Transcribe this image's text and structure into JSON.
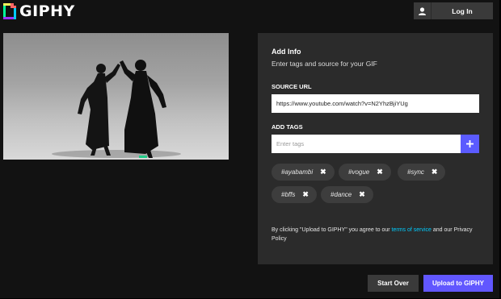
{
  "header": {
    "logo_text": "GIPHY",
    "login_label": "Log In"
  },
  "panel": {
    "title": "Add Info",
    "subtitle": "Enter tags and source for your GIF",
    "source_url_label": "SOURCE URL",
    "source_url_value": "https://www.youtube.com/watch?v=N2YhzBjiYUg",
    "add_tags_label": "ADD TAGS",
    "tags_placeholder": "Enter tags",
    "tags": [
      {
        "label": "#ayabambi"
      },
      {
        "label": "#vogue"
      },
      {
        "label": "#sync"
      },
      {
        "label": "#bffs"
      },
      {
        "label": "#dance"
      }
    ],
    "terms_prefix": "By clicking \"Upload to GIPHY\" you agree to our ",
    "terms_link": "terms of service",
    "terms_suffix": " and our Privacy Policy"
  },
  "actions": {
    "start_over": "Start Over",
    "upload": "Upload to GIPHY"
  },
  "colors": {
    "background": "#121212",
    "panel": "#2b2b2b",
    "accent": "#6157ff",
    "link": "#00ccff"
  }
}
